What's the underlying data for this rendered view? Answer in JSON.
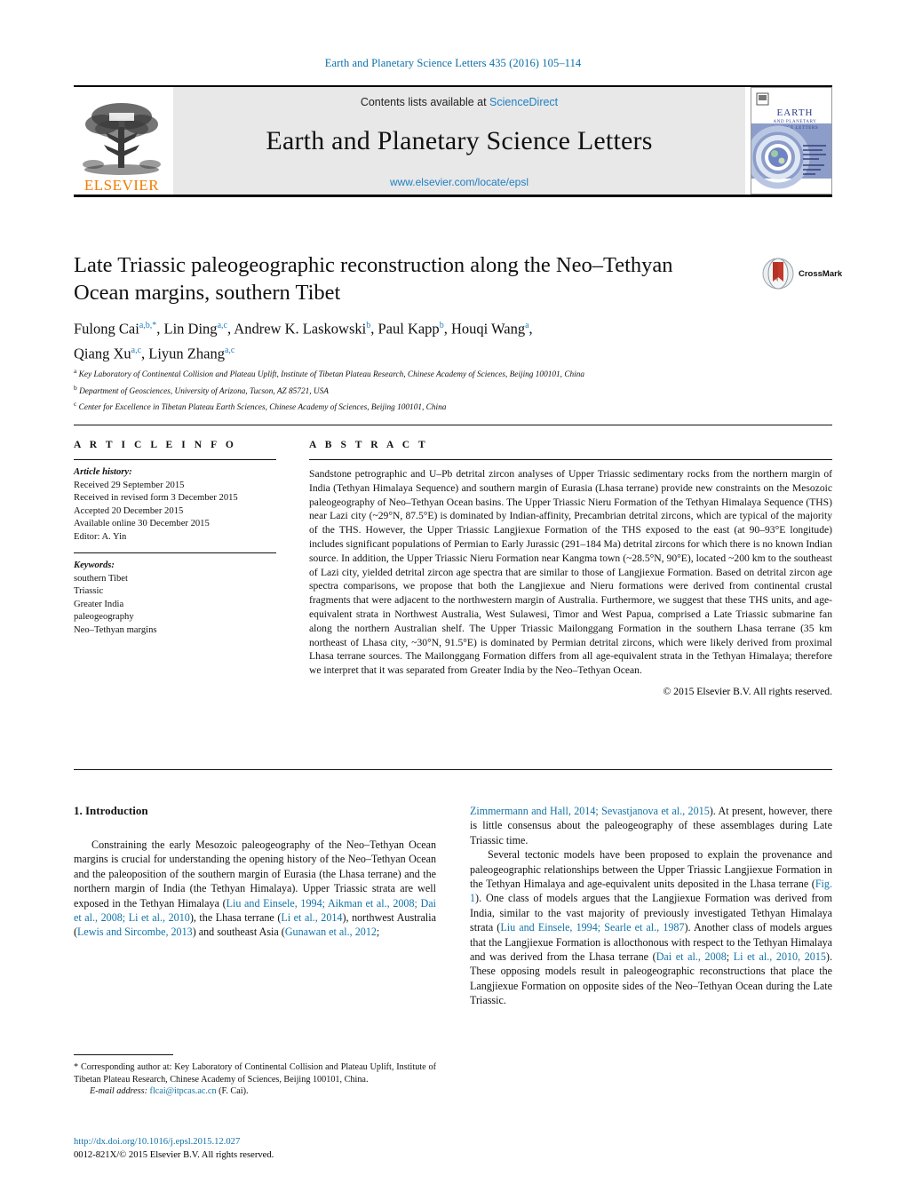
{
  "running_head": "Earth and Planetary Science Letters 435 (2016) 105–114",
  "masthead": {
    "publisher_name": "ELSEVIER",
    "contents_prefix": "Contents lists available at ",
    "sciencedirect": "ScienceDirect",
    "journal_name": "Earth and Planetary Science Letters",
    "journal_url": "www.elsevier.com/locate/epsl",
    "cover_title_line1": "EARTH",
    "cover_title_line2": "AND PLANETARY",
    "cover_title_line3": "SCIENCE LETTERS"
  },
  "article": {
    "title": "Late Triassic paleogeographic reconstruction along the Neo–Tethyan Ocean margins, southern Tibet",
    "crossmark_label": "CrossMark",
    "authors_line1": "Fulong Cai a,b,*, Lin Ding a,c, Andrew K. Laskowski b, Paul Kapp b, Houqi Wang a,",
    "authors_line2": "Qiang Xu a,c, Liyun Zhang a,c",
    "authors": [
      {
        "name": "Fulong Cai",
        "marks": "a,b,*"
      },
      {
        "name": "Lin Ding",
        "marks": "a,c"
      },
      {
        "name": "Andrew K. Laskowski",
        "marks": "b"
      },
      {
        "name": "Paul Kapp",
        "marks": "b"
      },
      {
        "name": "Houqi Wang",
        "marks": "a"
      },
      {
        "name": "Qiang Xu",
        "marks": "a,c"
      },
      {
        "name": "Liyun Zhang",
        "marks": "a,c"
      }
    ],
    "affiliations": [
      {
        "mark": "a",
        "text": "Key Laboratory of Continental Collision and Plateau Uplift, Institute of Tibetan Plateau Research, Chinese Academy of Sciences, Beijing 100101, China"
      },
      {
        "mark": "b",
        "text": "Department of Geosciences, University of Arizona, Tucson, AZ 85721, USA"
      },
      {
        "mark": "c",
        "text": "Center for Excellence in Tibetan Plateau Earth Sciences, Chinese Academy of Sciences, Beijing 100101, China"
      }
    ]
  },
  "article_info": {
    "heading": "A R T I C L E    I N F O",
    "history_label": "Article history:",
    "history": [
      "Received 29 September 2015",
      "Received in revised form 3 December 2015",
      "Accepted 20 December 2015",
      "Available online 30 December 2015",
      "Editor: A. Yin"
    ],
    "keywords_label": "Keywords:",
    "keywords": [
      "southern Tibet",
      "Triassic",
      "Greater India",
      "paleogeography",
      "Neo–Tethyan margins"
    ]
  },
  "abstract": {
    "heading": "A B S T R A C T",
    "text": "Sandstone petrographic and U–Pb detrital zircon analyses of Upper Triassic sedimentary rocks from the northern margin of India (Tethyan Himalaya Sequence) and southern margin of Eurasia (Lhasa terrane) provide new constraints on the Mesozoic paleogeography of Neo–Tethyan Ocean basins. The Upper Triassic Nieru Formation of the Tethyan Himalaya Sequence (THS) near Lazi city (~29°N, 87.5°E) is dominated by Indian-affinity, Precambrian detrital zircons, which are typical of the majority of the THS. However, the Upper Triassic Langjiexue Formation of the THS exposed to the east (at 90–93°E longitude) includes significant populations of Permian to Early Jurassic (291–184 Ma) detrital zircons for which there is no known Indian source. In addition, the Upper Triassic Nieru Formation near Kangma town (~28.5°N, 90°E), located ~200 km to the southeast of Lazi city, yielded detrital zircon age spectra that are similar to those of Langjiexue Formation. Based on detrital zircon age spectra comparisons, we propose that both the Langjiexue and Nieru formations were derived from continental crustal fragments that were adjacent to the northwestern margin of Australia. Furthermore, we suggest that these THS units, and age-equivalent strata in Northwest Australia, West Sulawesi, Timor and West Papua, comprised a Late Triassic submarine fan along the northern Australian shelf. The Upper Triassic Mailonggang Formation in the southern Lhasa terrane (35 km northeast of Lhasa city, ~30°N, 91.5°E) is dominated by Permian detrital zircons, which were likely derived from proximal Lhasa terrane sources. The Mailonggang Formation differs from all age-equivalent strata in the Tethyan Himalaya; therefore we interpret that it was separated from Greater India by the Neo–Tethyan Ocean.",
    "rights": "© 2015 Elsevier B.V. All rights reserved."
  },
  "body": {
    "section_number_title": "1. Introduction",
    "left_paragraph_1_a": "Constraining the early Mesozoic paleogeography of the Neo–Tethyan Ocean margins is crucial for understanding the opening history of the Neo–Tethyan Ocean and the paleoposition of the southern margin of Eurasia (the Lhasa terrane) and the northern margin of India (the Tethyan Himalaya). Upper Triassic strata are well exposed in the Tethyan Himalaya (",
    "ref_liu_einsele_list": "Liu and Einsele, 1994; Aikman et al., 2008; Dai et al., 2008; Li et al., 2010",
    "left_paragraph_1_b": "), the Lhasa terrane (",
    "ref_li_2014": "Li et al., 2014",
    "left_paragraph_1_c": "), northwest Australia (",
    "ref_lewis": "Lewis and Sircombe, 2013",
    "left_paragraph_1_d": ") and southeast Asia (",
    "ref_gunawan": "Gunawan et al., 2012",
    "left_paragraph_1_e": ";",
    "right_ref_zimmermann": "Zimmermann and Hall, 2014; Sevastjanova et al., 2015",
    "right_paragraph_1_tail": "). At present, however, there is little consensus about the paleogeography of these assemblages during Late Triassic time.",
    "right_paragraph_2_a": "Several tectonic models have been proposed to explain the provenance and paleogeographic relationships between the Upper Triassic Langjiexue Formation in the Tethyan Himalaya and age-equivalent units deposited in the Lhasa terrane (",
    "ref_fig1": "Fig. 1",
    "right_paragraph_2_b": "). One class of models argues that the Langjiexue Formation was derived from India, similar to the vast majority of previously investigated Tethyan Himalaya strata (",
    "ref_liu_searle": "Liu and Einsele, 1994; Searle et al., 1987",
    "right_paragraph_2_c": "). Another class of models argues that the Langjiexue Formation is allocthonous with respect to the Tethyan Himalaya and was derived from the Lhasa terrane (",
    "ref_dai_2008": "Dai et al., 2008",
    "right_paragraph_2_d": "; ",
    "ref_li_2010_2015": "Li et al., 2010, 2015",
    "right_paragraph_2_e": "). These opposing models result in paleogeographic reconstructions that place the Langjiexue Formation on opposite sides of the Neo–Tethyan Ocean during the Late Triassic."
  },
  "footnote": {
    "corresponding_mark": "*",
    "corresponding_text": "Corresponding author at: Key Laboratory of Continental Collision and Plateau Uplift, Institute of Tibetan Plateau Research, Chinese Academy of Sciences, Beijing 100101, China.",
    "email_label": "E-mail address:",
    "email": "flcai@itpcas.ac.cn",
    "email_suffix": "(F. Cai)."
  },
  "footer": {
    "doi": "http://dx.doi.org/10.1016/j.epsl.2015.12.027",
    "issn_rights": "0012-821X/© 2015 Elsevier B.V. All rights reserved."
  },
  "colors": {
    "link": "#1273a8",
    "elsevier_orange": "#f07c00",
    "masthead_bg": "#e8e8e8"
  }
}
